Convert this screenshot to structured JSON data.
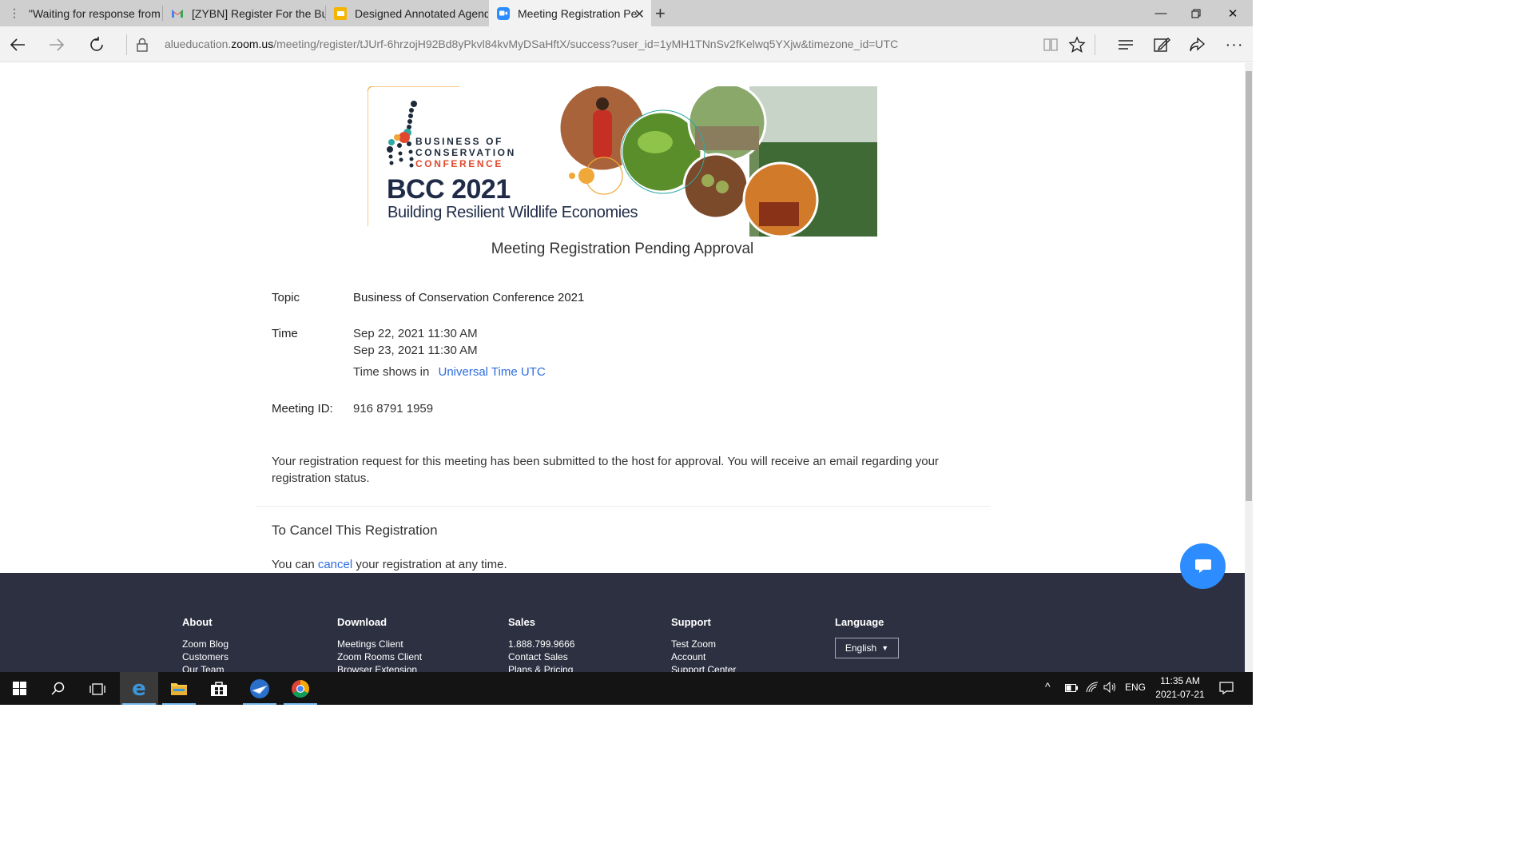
{
  "browser": {
    "tabs": [
      {
        "label": "\"Waiting for response from",
        "icon": "loading-icon"
      },
      {
        "label": "[ZYBN] Register For the Bus",
        "icon": "gmail-icon"
      },
      {
        "label": "Designed Annotated Agend",
        "icon": "slides-icon"
      },
      {
        "label": "Meeting Registration Pe",
        "icon": "zoom-icon",
        "active": true
      }
    ],
    "url_prefix": "alueducation.",
    "url_domain": "zoom.us",
    "url_path": "/meeting/register/tJUrf-6hrzojH92Bd8yPkvl84kvMyDSaHftX/success?user_id=1yMH1TNnSv2fKelwq5YXjw&timezone_id=UTC"
  },
  "banner": {
    "org_line1": "BUSINESS OF",
    "org_line2": "CONSERVATION",
    "org_line3": "CONFERENCE",
    "event_title": "BCC 2021",
    "event_subtitle": "Building Resilient Wildlife Economies"
  },
  "page_title": "Meeting Registration Pending Approval",
  "details": {
    "topic_label": "Topic",
    "topic_value": "Business of Conservation Conference 2021",
    "time_label": "Time",
    "time_1": "Sep 22, 2021 11:30 AM",
    "time_2": "Sep 23, 2021 11:30 AM",
    "timezone_prefix": "Time shows in",
    "timezone_link": "Universal Time UTC",
    "meeting_id_label": "Meeting ID:",
    "meeting_id_value": "916 8791 1959"
  },
  "notice": "Your registration request for this meeting has been submitted to the host for approval. You will receive an email regarding your registration status.",
  "cancel": {
    "title": "To Cancel This Registration",
    "text_before": "You can",
    "link": "cancel",
    "text_after": "your registration at any time."
  },
  "footer": {
    "about": {
      "heading": "About",
      "items": [
        "Zoom Blog",
        "Customers",
        "Our Team"
      ]
    },
    "download": {
      "heading": "Download",
      "items": [
        "Meetings Client",
        "Zoom Rooms Client",
        "Browser Extension"
      ]
    },
    "sales": {
      "heading": "Sales",
      "items": [
        "1.888.799.9666",
        "Contact Sales",
        "Plans & Pricing"
      ]
    },
    "support": {
      "heading": "Support",
      "items": [
        "Test Zoom",
        "Account",
        "Support Center"
      ]
    },
    "language": {
      "heading": "Language",
      "selected": "English"
    }
  },
  "taskbar": {
    "lang": "ENG",
    "time": "11:35 AM",
    "date": "2021-07-21"
  },
  "colors": {
    "link": "#2d6cdf",
    "footer_bg": "#2d3041",
    "chat_button": "#2d8cff",
    "brand_navy": "#1f2b47",
    "brand_red": "#e0492e"
  }
}
